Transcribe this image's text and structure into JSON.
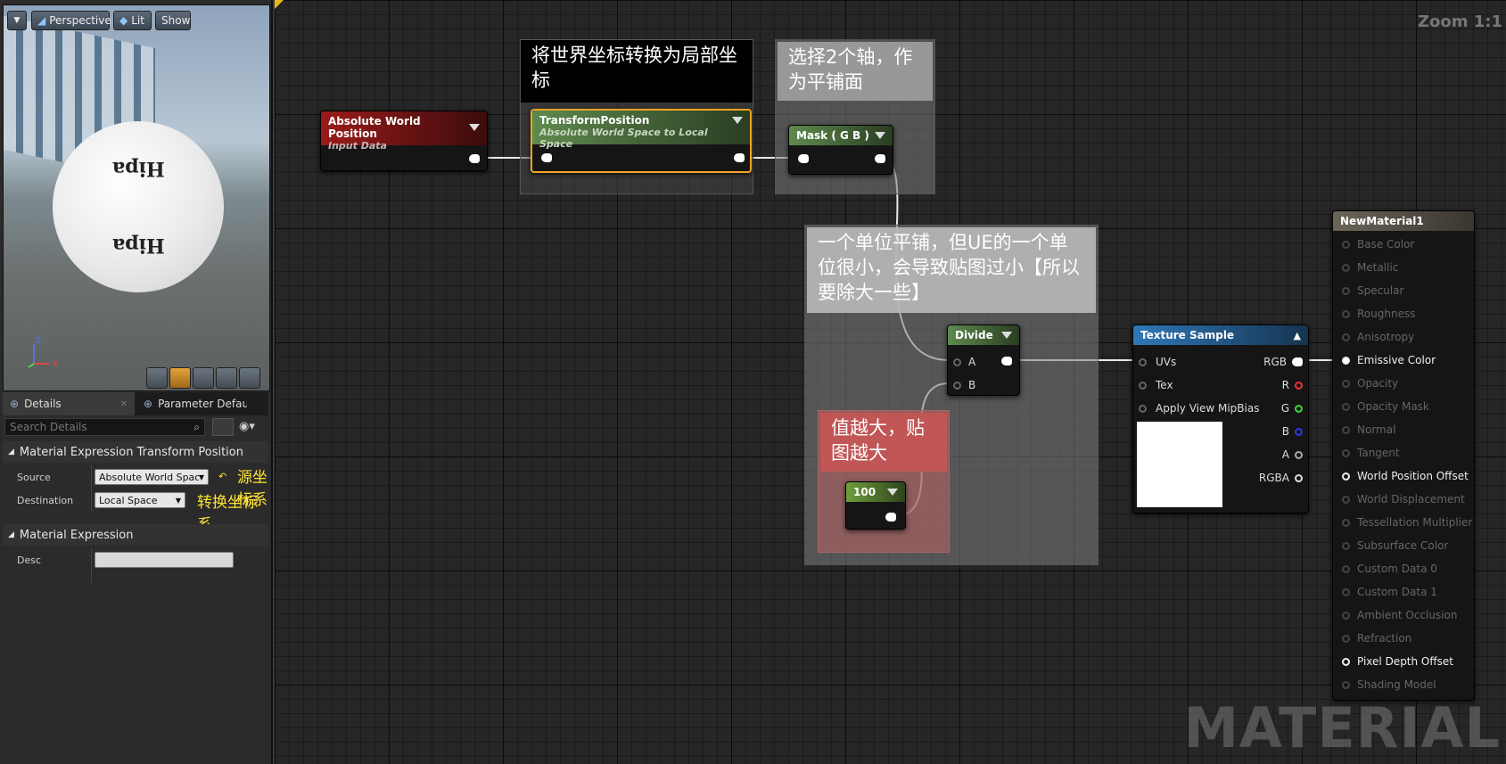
{
  "viewport": {
    "buttons": [
      "Perspective",
      "Lit",
      "Show"
    ],
    "sphere_text_top": "Hipa",
    "sphere_text_bottom": "Hipa",
    "axis": {
      "z": "Z",
      "x": "X"
    }
  },
  "details": {
    "tabs": [
      "Details",
      "Parameter Defaults"
    ],
    "search_placeholder": "Search Details",
    "section1": "Material Expression Transform Position",
    "source_label": "Source",
    "source_value": "Absolute World Space",
    "source_note": "源坐标系",
    "dest_label": "Destination",
    "dest_value": "Local Space",
    "dest_note": "转换坐标系",
    "section2": "Material Expression",
    "desc_label": "Desc",
    "desc_value": ""
  },
  "graph": {
    "zoom": "Zoom 1:1",
    "watermark": "MATERIAL",
    "comments": {
      "transform": "将世界坐标转换为局部坐标",
      "mask": "选择2个轴，作为平铺面",
      "divide": "一个单位平铺，但UE的一个单位很小，会导致贴图过小【所以要除大一些】",
      "value": "值越大，贴图越大"
    },
    "nodes": {
      "awp": {
        "title": "Absolute World Position",
        "sub": "Input Data"
      },
      "tp": {
        "title": "TransformPosition",
        "sub": "Absolute World Space to Local Space"
      },
      "mask": {
        "title": "Mask ( G B )"
      },
      "divide": {
        "title": "Divide",
        "a": "A",
        "b": "B"
      },
      "const": {
        "title": "100"
      },
      "tex": {
        "title": "Texture Sample",
        "inputs": [
          "UVs",
          "Tex",
          "Apply View MipBias"
        ],
        "outputs": [
          "RGB",
          "R",
          "G",
          "B",
          "A",
          "RGBA"
        ]
      }
    },
    "material": {
      "title": "NewMaterial1",
      "inputs": [
        "Base Color",
        "Metallic",
        "Specular",
        "Roughness",
        "Anisotropy",
        "Emissive Color",
        "Opacity",
        "Opacity Mask",
        "Normal",
        "Tangent",
        "World Position Offset",
        "World Displacement",
        "Tessellation Multiplier",
        "Subsurface Color",
        "Custom Data 0",
        "Custom Data 1",
        "Ambient Occlusion",
        "Refraction",
        "Pixel Depth Offset",
        "Shading Model"
      ]
    }
  }
}
